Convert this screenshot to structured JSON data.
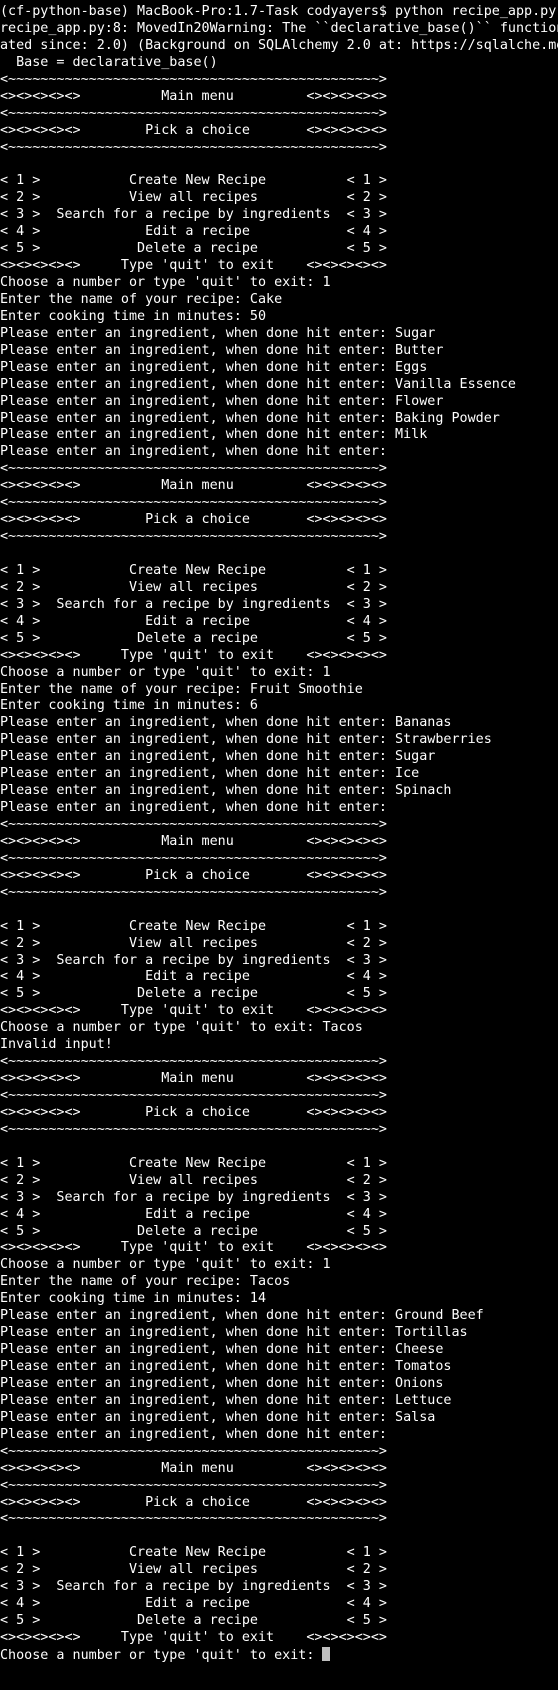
{
  "terminal": {
    "colors": {
      "background": "#000000",
      "foreground": "#ffffff",
      "cursor": "#bfbfbf"
    },
    "prompt_line": "Choose a number or type 'quit' to exit: ",
    "lines": [
      "(cf-python-base) MacBook-Pro:1.7-Task codyayers$ python recipe_app.py",
      "recipe_app.py:8: MovedIn20Warning: The ``declarative_base()`` function",
      "ated since: 2.0) (Background on SQLAlchemy 2.0 at: https://sqlalche.me",
      "  Base = declarative_base()",
      "<~~~~~~~~~~~~~~~~~~~~~~~~~~~~~~~~~~~~~~~~~~~~~~>",
      "<><><><><>          Main menu         <><><><><>",
      "<~~~~~~~~~~~~~~~~~~~~~~~~~~~~~~~~~~~~~~~~~~~~~~>",
      "<><><><><>        Pick a choice       <><><><><>",
      "<~~~~~~~~~~~~~~~~~~~~~~~~~~~~~~~~~~~~~~~~~~~~~~>",
      "",
      "< 1 >           Create New Recipe          < 1 >",
      "< 2 >           View all recipes           < 2 >",
      "< 3 >  Search for a recipe by ingredients  < 3 >",
      "< 4 >             Edit a recipe            < 4 >",
      "< 5 >            Delete a recipe           < 5 >",
      "<><><><><>     Type 'quit' to exit    <><><><><>",
      "Choose a number or type 'quit' to exit: 1",
      "Enter the name of your recipe: Cake",
      "Enter cooking time in minutes: 50",
      "Please enter an ingredient, when done hit enter: Sugar",
      "Please enter an ingredient, when done hit enter: Butter",
      "Please enter an ingredient, when done hit enter: Eggs",
      "Please enter an ingredient, when done hit enter: Vanilla Essence",
      "Please enter an ingredient, when done hit enter: Flower",
      "Please enter an ingredient, when done hit enter: Baking Powder",
      "Please enter an ingredient, when done hit enter: Milk",
      "Please enter an ingredient, when done hit enter:",
      "<~~~~~~~~~~~~~~~~~~~~~~~~~~~~~~~~~~~~~~~~~~~~~~>",
      "<><><><><>          Main menu         <><><><><>",
      "<~~~~~~~~~~~~~~~~~~~~~~~~~~~~~~~~~~~~~~~~~~~~~~>",
      "<><><><><>        Pick a choice       <><><><><>",
      "<~~~~~~~~~~~~~~~~~~~~~~~~~~~~~~~~~~~~~~~~~~~~~~>",
      "",
      "< 1 >           Create New Recipe          < 1 >",
      "< 2 >           View all recipes           < 2 >",
      "< 3 >  Search for a recipe by ingredients  < 3 >",
      "< 4 >             Edit a recipe            < 4 >",
      "< 5 >            Delete a recipe           < 5 >",
      "<><><><><>     Type 'quit' to exit    <><><><><>",
      "Choose a number or type 'quit' to exit: 1",
      "Enter the name of your recipe: Fruit Smoothie",
      "Enter cooking time in minutes: 6",
      "Please enter an ingredient, when done hit enter: Bananas",
      "Please enter an ingredient, when done hit enter: Strawberries",
      "Please enter an ingredient, when done hit enter: Sugar",
      "Please enter an ingredient, when done hit enter: Ice",
      "Please enter an ingredient, when done hit enter: Spinach",
      "Please enter an ingredient, when done hit enter:",
      "<~~~~~~~~~~~~~~~~~~~~~~~~~~~~~~~~~~~~~~~~~~~~~~>",
      "<><><><><>          Main menu         <><><><><>",
      "<~~~~~~~~~~~~~~~~~~~~~~~~~~~~~~~~~~~~~~~~~~~~~~>",
      "<><><><><>        Pick a choice       <><><><><>",
      "<~~~~~~~~~~~~~~~~~~~~~~~~~~~~~~~~~~~~~~~~~~~~~~>",
      "",
      "< 1 >           Create New Recipe          < 1 >",
      "< 2 >           View all recipes           < 2 >",
      "< 3 >  Search for a recipe by ingredients  < 3 >",
      "< 4 >             Edit a recipe            < 4 >",
      "< 5 >            Delete a recipe           < 5 >",
      "<><><><><>     Type 'quit' to exit    <><><><><>",
      "Choose a number or type 'quit' to exit: Tacos",
      "Invalid input!",
      "<~~~~~~~~~~~~~~~~~~~~~~~~~~~~~~~~~~~~~~~~~~~~~~>",
      "<><><><><>          Main menu         <><><><><>",
      "<~~~~~~~~~~~~~~~~~~~~~~~~~~~~~~~~~~~~~~~~~~~~~~>",
      "<><><><><>        Pick a choice       <><><><><>",
      "<~~~~~~~~~~~~~~~~~~~~~~~~~~~~~~~~~~~~~~~~~~~~~~>",
      "",
      "< 1 >           Create New Recipe          < 1 >",
      "< 2 >           View all recipes           < 2 >",
      "< 3 >  Search for a recipe by ingredients  < 3 >",
      "< 4 >             Edit a recipe            < 4 >",
      "< 5 >            Delete a recipe           < 5 >",
      "<><><><><>     Type 'quit' to exit    <><><><><>",
      "Choose a number or type 'quit' to exit: 1",
      "Enter the name of your recipe: Tacos",
      "Enter cooking time in minutes: 14",
      "Please enter an ingredient, when done hit enter: Ground Beef",
      "Please enter an ingredient, when done hit enter: Tortillas",
      "Please enter an ingredient, when done hit enter: Cheese",
      "Please enter an ingredient, when done hit enter: Tomatos",
      "Please enter an ingredient, when done hit enter: Onions",
      "Please enter an ingredient, when done hit enter: Lettuce",
      "Please enter an ingredient, when done hit enter: Salsa",
      "Please enter an ingredient, when done hit enter:",
      "<~~~~~~~~~~~~~~~~~~~~~~~~~~~~~~~~~~~~~~~~~~~~~~>",
      "<><><><><>          Main menu         <><><><><>",
      "<~~~~~~~~~~~~~~~~~~~~~~~~~~~~~~~~~~~~~~~~~~~~~~>",
      "<><><><><>        Pick a choice       <><><><><>",
      "<~~~~~~~~~~~~~~~~~~~~~~~~~~~~~~~~~~~~~~~~~~~~~~>",
      "",
      "< 1 >           Create New Recipe          < 1 >",
      "< 2 >           View all recipes           < 2 >",
      "< 3 >  Search for a recipe by ingredients  < 3 >",
      "< 4 >             Edit a recipe            < 4 >",
      "< 5 >            Delete a recipe           < 5 >",
      "<><><><><>     Type 'quit' to exit    <><><><><>"
    ]
  }
}
